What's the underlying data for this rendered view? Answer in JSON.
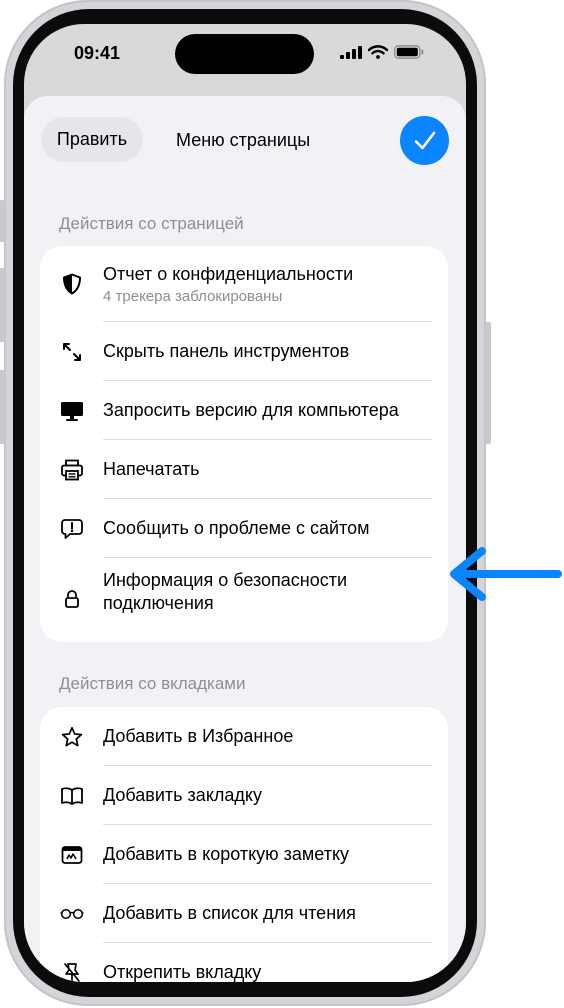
{
  "status_bar": {
    "time": "09:41"
  },
  "header": {
    "edit_label": "Править",
    "title": "Меню страницы",
    "done_icon": "checkmark-icon"
  },
  "page_actions": {
    "title": "Действия со страницей",
    "items": [
      {
        "label": "Отчет о конфиденциальности",
        "sublabel": "4 трекера заблокированы",
        "icon": "privacy-shield-icon"
      },
      {
        "label": "Скрыть панель инструментов",
        "icon": "resize-arrows-icon"
      },
      {
        "label": "Запросить версию для компьютера",
        "icon": "desktop-icon"
      },
      {
        "label": "Напечатать",
        "icon": "printer-icon"
      },
      {
        "label": "Сообщить о проблеме с сайтом",
        "icon": "report-bubble-icon"
      },
      {
        "label": "Информация о безопасности",
        "label_line2": "подключения",
        "icon": "lock-icon"
      }
    ]
  },
  "tab_actions": {
    "title": "Действия со вкладками",
    "items": [
      {
        "label": "Добавить в Избранное",
        "icon": "star-icon"
      },
      {
        "label": "Добавить закладку",
        "icon": "book-icon"
      },
      {
        "label": "Добавить в короткую заметку",
        "icon": "quick-note-icon"
      },
      {
        "label": "Добавить в список для чтения",
        "icon": "glasses-icon"
      },
      {
        "label": "Открепить вкладку",
        "icon": "unpin-icon"
      }
    ]
  },
  "colors": {
    "accent": "#0a84ff",
    "sheet_bg": "#f2f2f6",
    "secondary_text": "#8e8e93"
  }
}
